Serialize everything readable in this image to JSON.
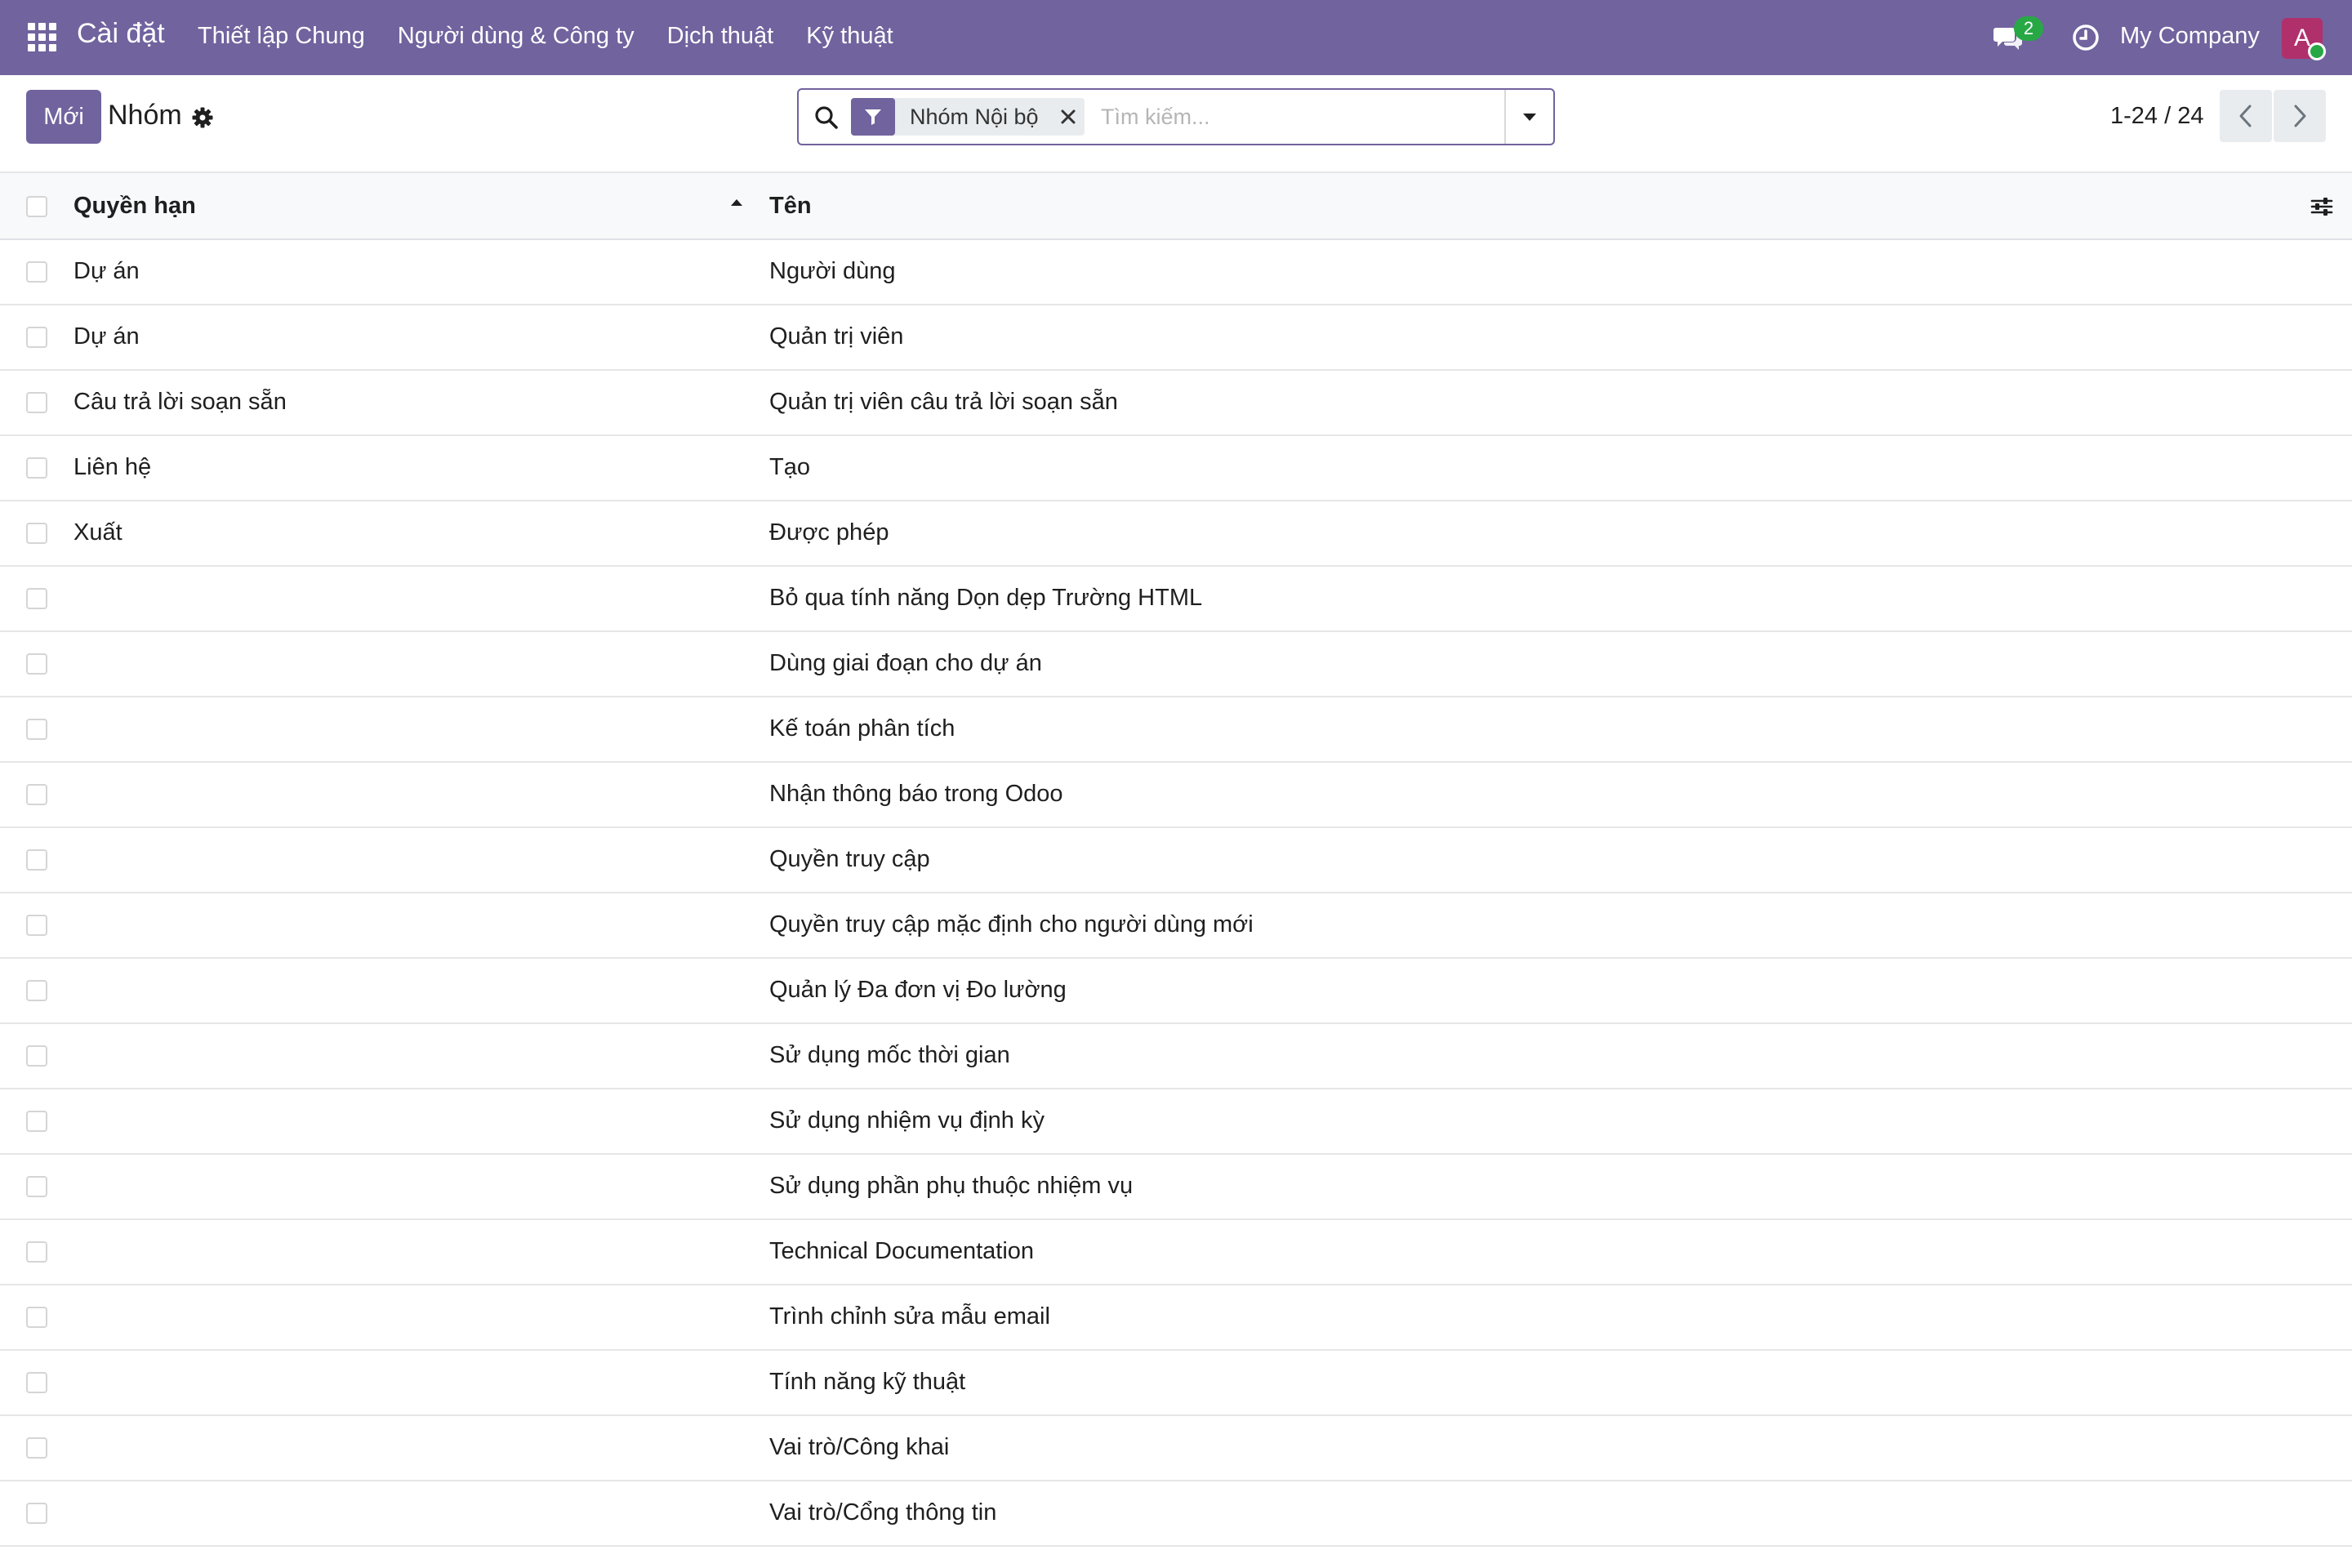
{
  "navbar": {
    "app_name": "Cài đặt",
    "menu": [
      "Thiết lập Chung",
      "Người dùng & Công ty",
      "Dịch thuật",
      "Kỹ thuật"
    ],
    "messages_count": "2",
    "company": "My Company",
    "avatar_initial": "A"
  },
  "control_panel": {
    "new_button": "Mới",
    "title": "Nhóm",
    "search": {
      "facet_label": "Nhóm Nội bộ",
      "placeholder": "Tìm kiếm..."
    },
    "pager": "1-24 / 24"
  },
  "table": {
    "columns": [
      "Quyền hạn",
      "Tên"
    ],
    "rows": [
      {
        "access": "Dự án",
        "name": "Người dùng"
      },
      {
        "access": "Dự án",
        "name": "Quản trị viên"
      },
      {
        "access": "Câu trả lời soạn sẵn",
        "name": "Quản trị viên câu trả lời soạn sẵn"
      },
      {
        "access": "Liên hệ",
        "name": "Tạo"
      },
      {
        "access": "Xuất",
        "name": "Được phép"
      },
      {
        "access": "",
        "name": "Bỏ qua tính năng Dọn dẹp Trường HTML"
      },
      {
        "access": "",
        "name": "Dùng giai đoạn cho dự án"
      },
      {
        "access": "",
        "name": "Kế toán phân tích"
      },
      {
        "access": "",
        "name": "Nhận thông báo trong Odoo"
      },
      {
        "access": "",
        "name": "Quyền truy cập"
      },
      {
        "access": "",
        "name": "Quyền truy cập mặc định cho người dùng mới"
      },
      {
        "access": "",
        "name": "Quản lý Đa đơn vị Đo lường"
      },
      {
        "access": "",
        "name": "Sử dụng mốc thời gian"
      },
      {
        "access": "",
        "name": "Sử dụng nhiệm vụ định kỳ"
      },
      {
        "access": "",
        "name": "Sử dụng phần phụ thuộc nhiệm vụ"
      },
      {
        "access": "",
        "name": "Technical Documentation"
      },
      {
        "access": "",
        "name": "Trình chỉnh sửa mẫu email"
      },
      {
        "access": "",
        "name": "Tính năng kỹ thuật"
      },
      {
        "access": "",
        "name": "Vai trò/Công khai"
      },
      {
        "access": "",
        "name": "Vai trò/Cổng thông tin"
      }
    ]
  },
  "colors": {
    "brand": "#71639e",
    "badge": "#28a745",
    "avatar": "#b0306c"
  },
  "icons": [
    "apps-grid-icon",
    "chat-icon",
    "clock-icon",
    "gear-icon",
    "search-icon",
    "filter-icon",
    "close-icon",
    "caret-down-icon",
    "chevron-left-icon",
    "chevron-right-icon",
    "sort-asc-icon",
    "optional-columns-icon"
  ]
}
